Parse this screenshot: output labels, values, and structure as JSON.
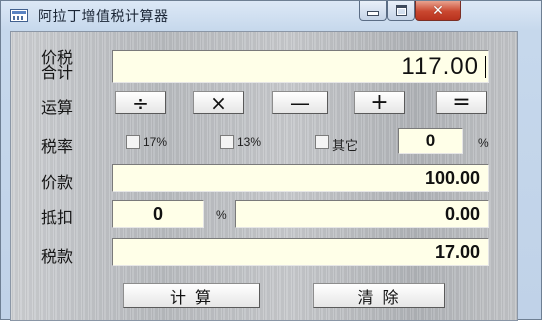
{
  "window": {
    "title": "阿拉丁增值税计算器",
    "icon": "calculator-app-icon",
    "controls": {
      "minimize": "minimize-icon",
      "maximize": "maximize-icon",
      "close": "✕"
    }
  },
  "total": {
    "label_line1": "价税",
    "label_line2": "合计",
    "value": "117.00"
  },
  "operations": {
    "label": "运算",
    "buttons": [
      "÷",
      "×",
      "—",
      "+",
      "="
    ]
  },
  "tax_rate": {
    "label": "税率",
    "options": [
      {
        "label": "17%",
        "checked": false
      },
      {
        "label": "13%",
        "checked": false
      },
      {
        "label": "其它",
        "checked": false
      }
    ],
    "other_value": "0",
    "unit": "%"
  },
  "price": {
    "label": "价款",
    "value": "100.00"
  },
  "deduction": {
    "label": "抵扣",
    "percent": "0",
    "unit": "%",
    "amount": "0.00"
  },
  "tax": {
    "label": "税款",
    "value": "17.00"
  },
  "actions": {
    "calculate": "计 算",
    "clear": "清 除"
  },
  "colors": {
    "field_bg": "#ffffe8",
    "close_red": "#c9472f",
    "title_blue": "#c6d8ec"
  }
}
